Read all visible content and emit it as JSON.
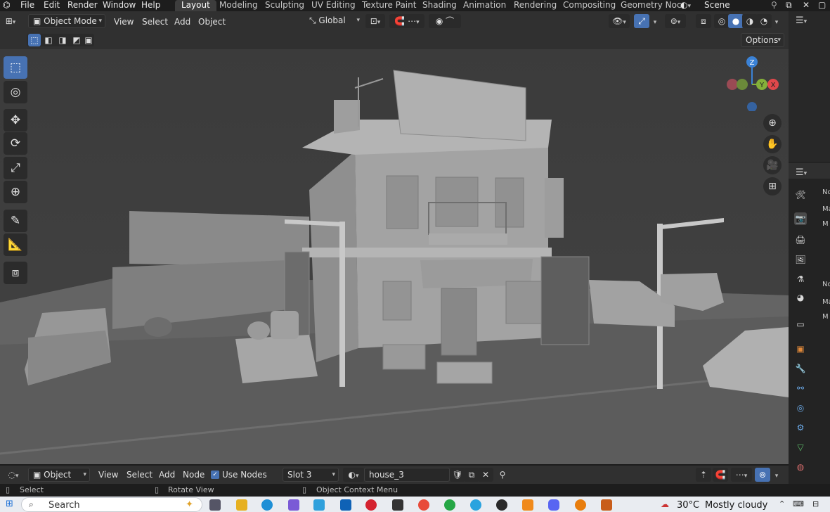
{
  "topbar": {
    "menus": [
      "File",
      "Edit",
      "Render",
      "Window",
      "Help"
    ],
    "workspaces": [
      "Layout",
      "Modeling",
      "Sculpting",
      "UV Editing",
      "Texture Paint",
      "Shading",
      "Animation",
      "Rendering",
      "Compositing",
      "Geometry Noc"
    ],
    "active_workspace": "Layout",
    "scene_label": "Scene"
  },
  "viewport_header": {
    "mode": "Object Mode",
    "menus": [
      "View",
      "Select",
      "Add",
      "Object"
    ],
    "transform_orientation": "Global",
    "options_label": "Options"
  },
  "gizmo": {
    "z": "Z",
    "y": "Y",
    "x": "X"
  },
  "toolbar": {
    "tools": [
      "select-box-icon",
      "cursor-icon",
      "move-icon",
      "rotate-icon",
      "scale-icon",
      "transform-icon",
      "annotate-icon",
      "measure-icon",
      "add-cube-icon"
    ],
    "active_index": 0
  },
  "nav_buttons": [
    "zoom-icon",
    "hand-pan-icon",
    "camera-icon",
    "grid-ortho-icon"
  ],
  "properties_labels": [
    "No",
    "Ma",
    "M",
    "No",
    "Ma",
    "M"
  ],
  "shader_header": {
    "editor_type": "Object",
    "menus": [
      "View",
      "Select",
      "Add",
      "Node"
    ],
    "use_nodes_label": "Use Nodes",
    "use_nodes_checked": true,
    "slot": "Slot 3",
    "material": "house_3"
  },
  "status_bar": {
    "left": "Select",
    "middle": "Rotate View",
    "right": "Object Context Menu"
  },
  "taskbar": {
    "search_placeholder": "Search",
    "weather_temp": "30°C",
    "weather_desc": "Mostly cloudy"
  },
  "colors": {
    "accent": "#4772b3",
    "axis_x": "#e0484b",
    "axis_y": "#84b03a",
    "axis_z": "#3b82d6"
  }
}
